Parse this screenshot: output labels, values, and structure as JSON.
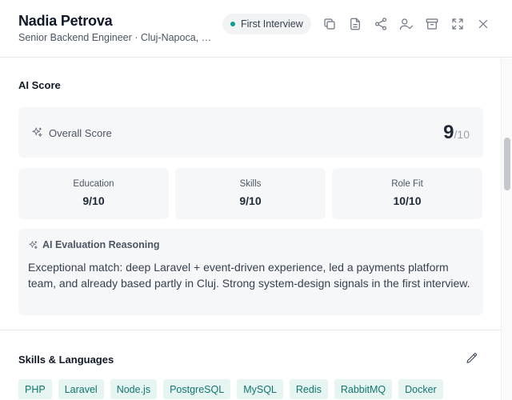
{
  "candidate": {
    "name": "Nadia Petrova",
    "subtitle": "Senior Backend Engineer · Cluj-Napoca, R...",
    "stage": "First Interview",
    "stage_color": "#0f9d8f"
  },
  "header_actions": [
    {
      "name": "copy-icon"
    },
    {
      "name": "document-icon"
    },
    {
      "name": "share-icon"
    },
    {
      "name": "user-check-icon"
    },
    {
      "name": "archive-icon"
    },
    {
      "name": "expand-icon"
    },
    {
      "name": "close-icon"
    }
  ],
  "ai_score": {
    "title": "AI Score",
    "overall_label": "Overall Score",
    "overall_value": "9",
    "overall_denominator": "/10",
    "breakdown": [
      {
        "label": "Education",
        "value": "9/10"
      },
      {
        "label": "Skills",
        "value": "9/10"
      },
      {
        "label": "Role Fit",
        "value": "10/10"
      }
    ],
    "reasoning_title": "AI Evaluation Reasoning",
    "reasoning_text": "Exceptional match: deep Laravel + event-driven experience, led a payments platform team, and already based partly in Cluj. Strong system-design signals in the first interview."
  },
  "skills": {
    "title": "Skills & Languages",
    "tags": [
      "PHP",
      "Laravel",
      "Node.js",
      "PostgreSQL",
      "MySQL",
      "Redis",
      "RabbitMQ",
      "Docker"
    ],
    "tag_color": "#0f766e"
  }
}
